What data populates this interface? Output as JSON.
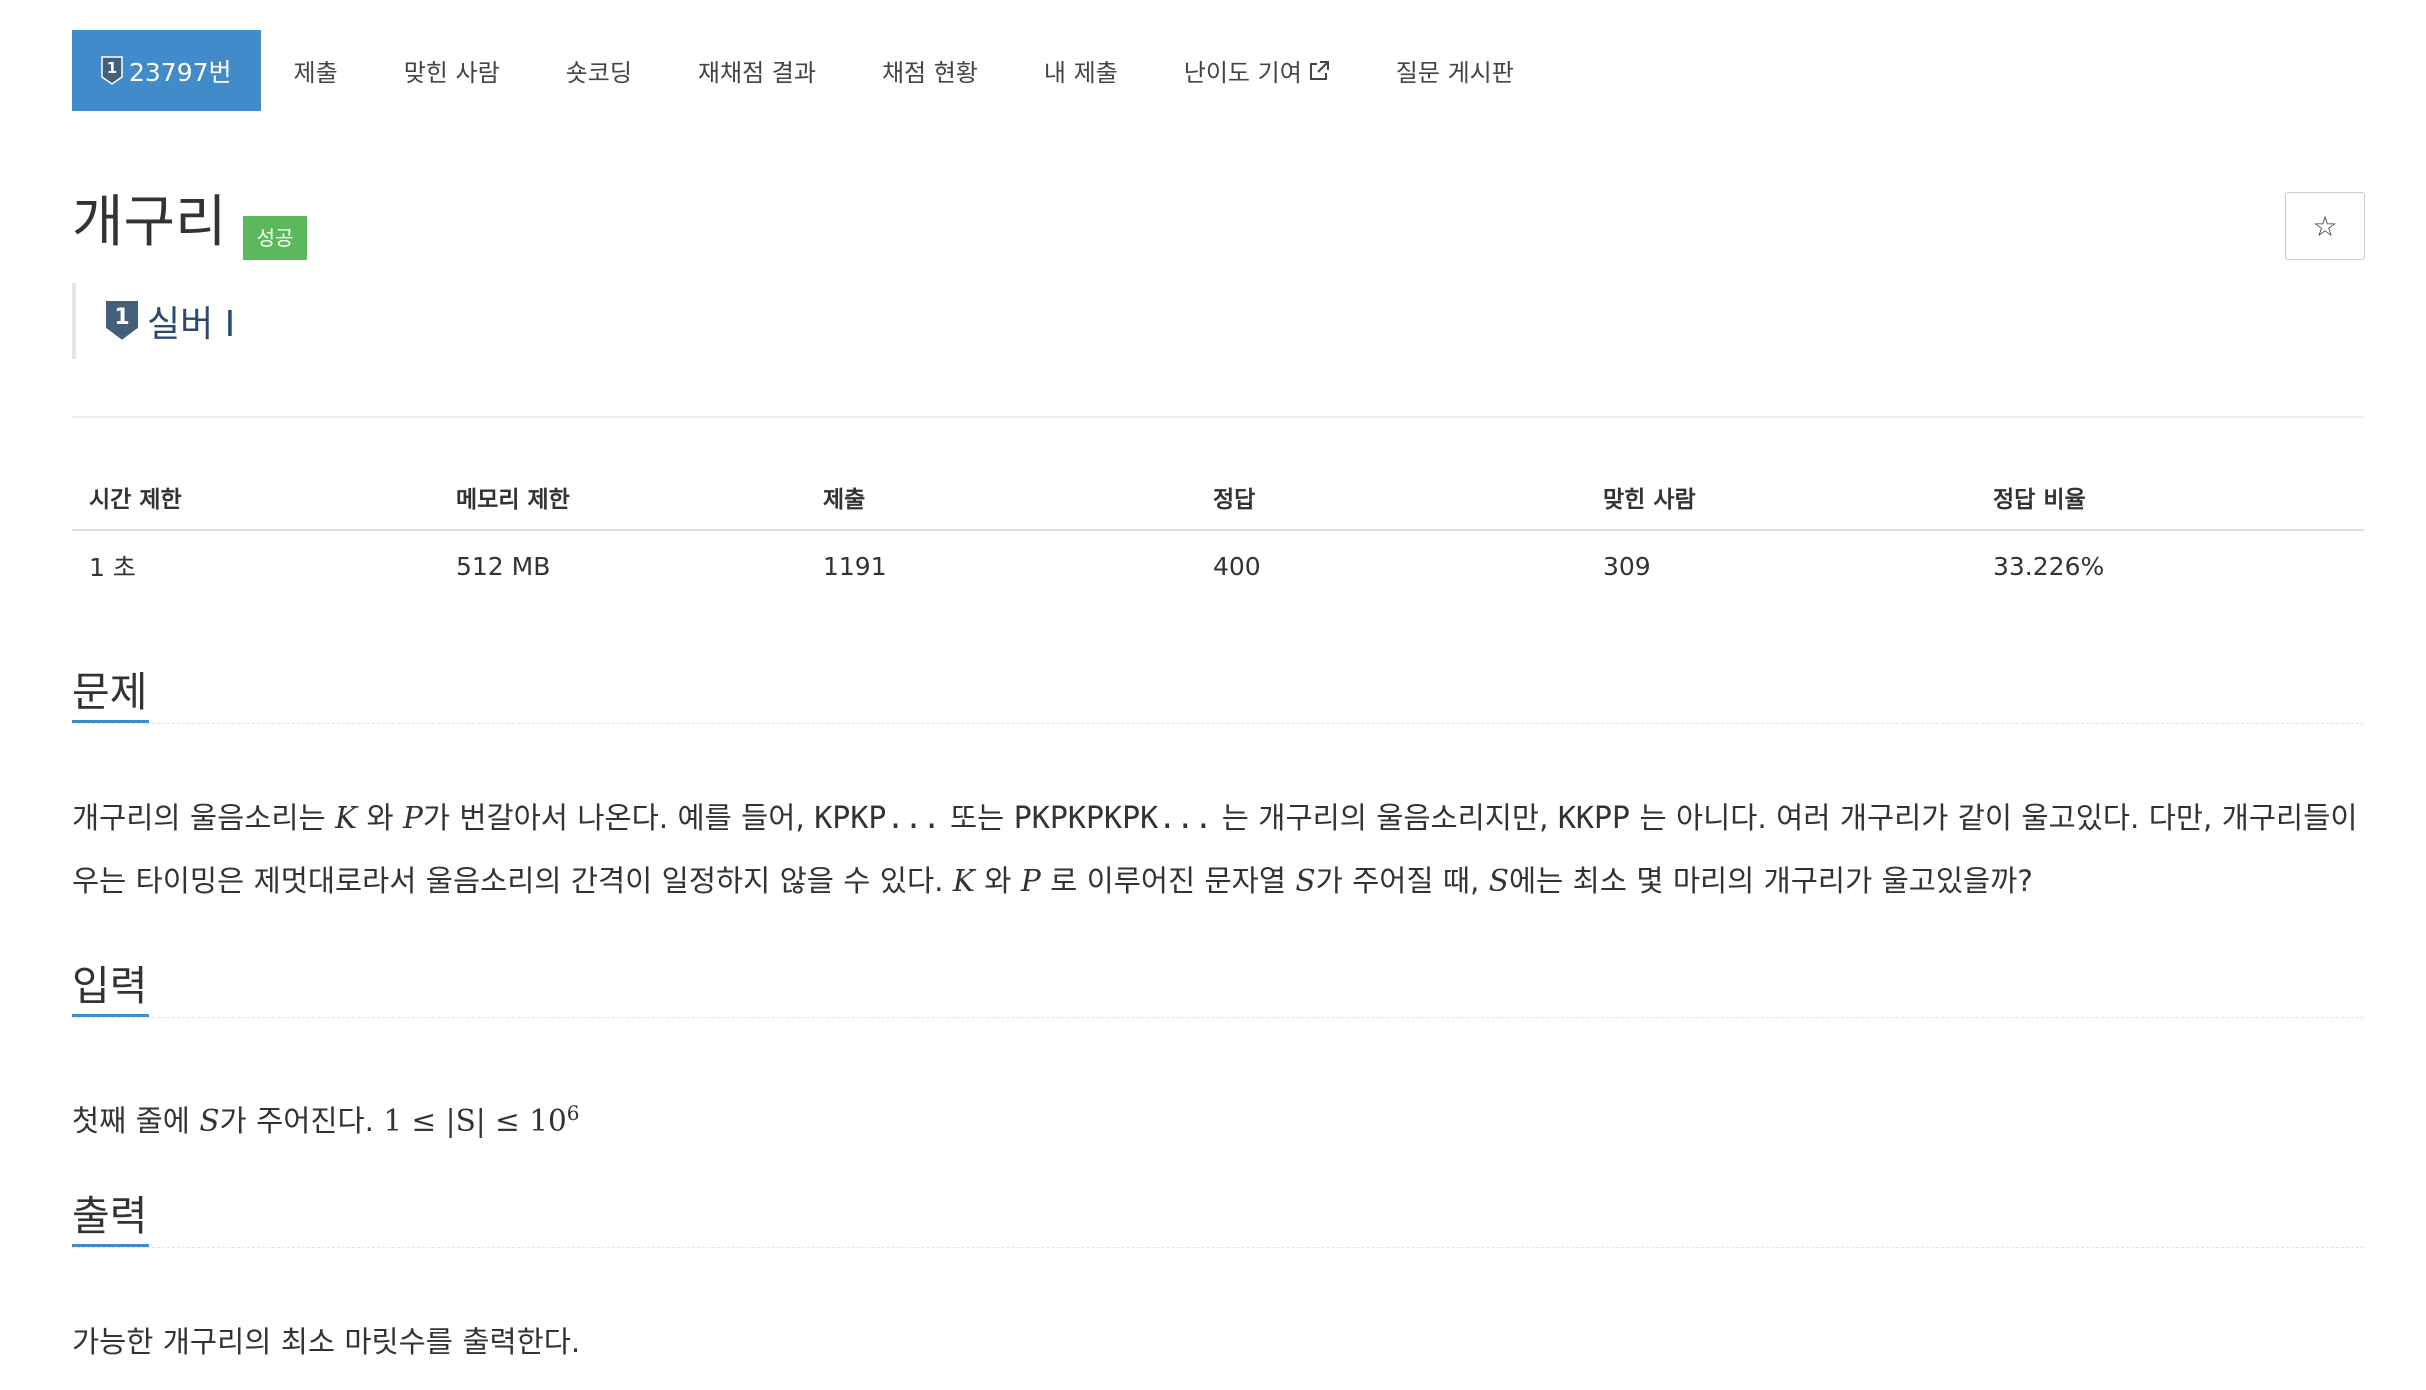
{
  "tabs": {
    "problem": "23797번",
    "submit": "제출",
    "solved_users": "맞힌 사람",
    "short_coding": "숏코딩",
    "rejudge": "재채점 결과",
    "judge_status": "채점 현황",
    "my_submissions": "내 제출",
    "difficulty": "난이도 기여",
    "board": "질문 게시판"
  },
  "problem": {
    "title": "개구리",
    "status_badge": "성공",
    "tier": "실버 I",
    "tier_number": "1"
  },
  "info": {
    "headers": [
      "시간 제한",
      "메모리 제한",
      "제출",
      "정답",
      "맞힌 사람",
      "정답 비율"
    ],
    "values": [
      "1 초",
      "512 MB",
      "1191",
      "400",
      "309",
      "33.226%"
    ]
  },
  "sections": {
    "problem": {
      "title": "문제",
      "p1": "개구리의 울음소리는",
      "k": "K",
      "wa1": "와",
      "p": "P",
      "p2": "가 번갈아서 나온다. 예를 들어,",
      "ex1": "KPKP...",
      "p3": "또는",
      "ex2": "PKPKPKPK...",
      "p4": "는 개구리의 울음소리지만,",
      "ex3": "KKPP",
      "p5": "는 아니다. 여러 개구리가 같이 울고있다. 다만, 개구리들이 우는 타이밍은 제멋대로라서 울음소리의 간격이 일정하지 않을 수 있다.",
      "k2": "K",
      "wa2": "와",
      "p_2": "P",
      "p6": "로 이루어진 문자열",
      "s1": "S",
      "p7": "가 주어질 때,",
      "s2": "S",
      "p8": "에는 최소 몇 마리의 개구리가 울고있을까?"
    },
    "input": {
      "title": "입력",
      "text1": "첫째 줄에",
      "s": "S",
      "text2": "가 주어진다.",
      "constraint": "1 ≤ |S| ≤ 10",
      "exponent": "6"
    },
    "output": {
      "title": "출력",
      "text": "가능한 개구리의 최소 마릿수를 출력한다."
    }
  },
  "colors": {
    "accent": "#428bca",
    "success": "#5cb85c",
    "tier_silver": "#435f7a"
  },
  "icons": {
    "tier": "silver-tier-shield-icon",
    "external": "external-link-icon",
    "star": "star-outline-icon"
  }
}
